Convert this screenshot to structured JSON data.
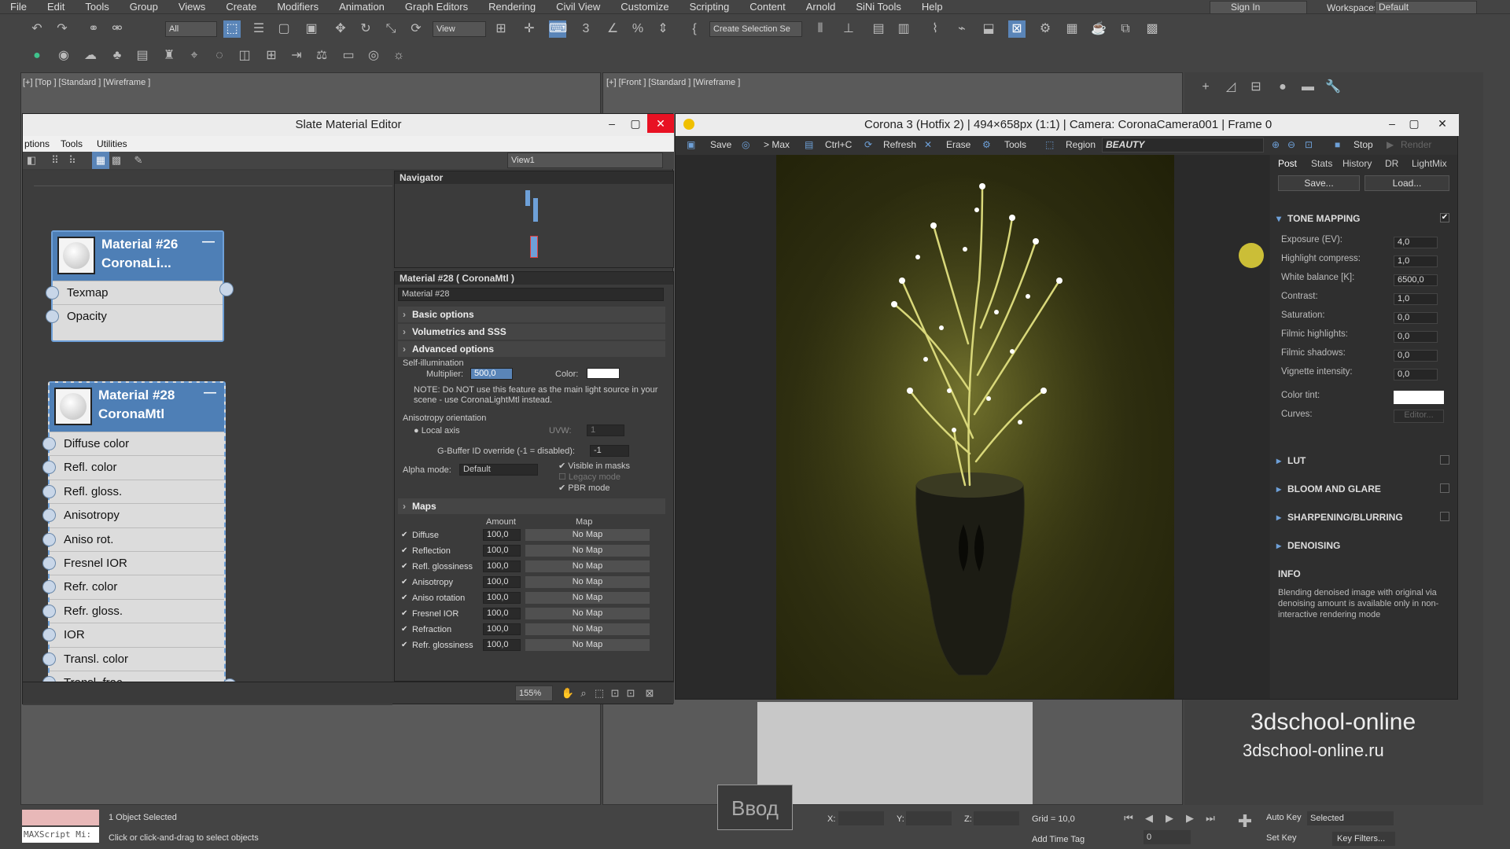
{
  "menu": [
    "File",
    "Edit",
    "Tools",
    "Group",
    "Views",
    "Create",
    "Modifiers",
    "Animation",
    "Graph Editors",
    "Rendering",
    "Civil View",
    "Customize",
    "Scripting",
    "Content",
    "Arnold",
    "SiNi Tools",
    "Help"
  ],
  "signin": "Sign In",
  "workspaces_label": "Workspaces:",
  "workspaces_value": "Default",
  "toolbar": {
    "filter": "All",
    "refcoord": "View",
    "selset": "Create Selection Se"
  },
  "viewports": {
    "top_label": "[+] [Top ] [Standard ] [Wireframe ]",
    "front_label": "[+] [Front ] [Standard ] [Wireframe ]"
  },
  "slate": {
    "title": "Slate Material Editor",
    "menu": [
      "ptions",
      "Tools",
      "Utilities"
    ],
    "view": "View1",
    "node1": {
      "title1": "Material #26",
      "title2": "CoronaLi...",
      "slots": [
        "Texmap",
        "Opacity"
      ]
    },
    "node2": {
      "title1": "Material #28",
      "title2": "CoronaMtl",
      "slots": [
        "Diffuse color",
        "Refl. color",
        "Refl. gloss.",
        "Anisotropy",
        "Aniso rot.",
        "Fresnel IOR",
        "Refr. color",
        "Refr. gloss.",
        "IOR",
        "Transl. color",
        "Transl. frac."
      ]
    },
    "navigator": "Navigator",
    "params_title": "Material #28  ( CoronaMtl )",
    "params_name": "Material #28",
    "rollouts": [
      "Basic options",
      "Volumetrics and SSS",
      "Advanced options"
    ],
    "self_illum": "Self-illumination",
    "multiplier_label": "Multiplier:",
    "multiplier": "500,0",
    "color_label": "Color:",
    "note": "NOTE: Do NOT use this feature as the main light source in your scene - use CoronaLightMtl instead.",
    "aniso": "Anisotropy orientation",
    "local_axis": "Local axis",
    "uvw": "UVW:",
    "uvw_val": "1",
    "gbuffer_label": "G-Buffer ID override (-1 = disabled):",
    "gbuffer": "-1",
    "alpha_label": "Alpha mode:",
    "alpha": "Default",
    "visible_masks": "Visible in masks",
    "legacy": "Legacy mode",
    "pbr": "PBR mode",
    "maps_title": "Maps",
    "amount_hdr": "Amount",
    "map_hdr": "Map",
    "maps": [
      {
        "name": "Diffuse",
        "amount": "100,0",
        "map": "No Map"
      },
      {
        "name": "Reflection",
        "amount": "100,0",
        "map": "No Map"
      },
      {
        "name": "Refl. glossiness",
        "amount": "100,0",
        "map": "No Map"
      },
      {
        "name": "Anisotropy",
        "amount": "100,0",
        "map": "No Map"
      },
      {
        "name": "Aniso rotation",
        "amount": "100,0",
        "map": "No Map"
      },
      {
        "name": "Fresnel IOR",
        "amount": "100,0",
        "map": "No Map"
      },
      {
        "name": "Refraction",
        "amount": "100,0",
        "map": "No Map"
      },
      {
        "name": "Refr. glossiness",
        "amount": "100,0",
        "map": "No Map"
      }
    ],
    "zoom": "155%"
  },
  "corona": {
    "title": "Corona 3 (Hotfix 2) | 494×658px (1:1) | Camera: CoronaCamera001 | Frame 0",
    "buttons": [
      "Save",
      "> Max",
      "Ctrl+C",
      "Refresh",
      "Erase",
      "Tools",
      "Region"
    ],
    "beauty": "BEAUTY",
    "stop": "Stop",
    "render": "Render",
    "tabs": [
      "Post",
      "Stats",
      "History",
      "DR",
      "LightMix"
    ],
    "save": "Save...",
    "load": "Load...",
    "tone_mapping": "TONE MAPPING",
    "tm_rows": [
      {
        "label": "Exposure (EV):",
        "value": "4,0"
      },
      {
        "label": "Highlight compress:",
        "value": "1,0"
      },
      {
        "label": "White balance [K]:",
        "value": "6500,0"
      },
      {
        "label": "Contrast:",
        "value": "1,0"
      },
      {
        "label": "Saturation:",
        "value": "0,0"
      },
      {
        "label": "Filmic highlights:",
        "value": "0,0"
      },
      {
        "label": "Filmic shadows:",
        "value": "0,0"
      },
      {
        "label": "Vignette intensity:",
        "value": "0,0"
      }
    ],
    "color_tint": "Color tint:",
    "curves": "Curves:",
    "editor": "Editor...",
    "sections": [
      "LUT",
      "BLOOM AND GLARE",
      "SHARPENING/BLURRING",
      "DENOISING"
    ],
    "info_title": "INFO",
    "info": "Blending denoised image with original via denoising amount is available only in non-interactive rendering mode"
  },
  "status": {
    "selected": "1 Object Selected",
    "hint": "Click or click-and-drag to select objects",
    "maxscript": "MAXScript Mi:",
    "input": "Ввод",
    "x_label": "X:",
    "y_label": "Y:",
    "z_label": "Z:",
    "grid": "Grid = 10,0",
    "add_time_tag": "Add Time Tag",
    "auto_key": "Auto Key",
    "set_key": "Set Key",
    "selected_mode": "Selected",
    "key_filters": "Key Filters...",
    "frame": "0"
  },
  "watermark": {
    "line1": "3dschool-online",
    "line2": "3dschool-online.ru"
  }
}
